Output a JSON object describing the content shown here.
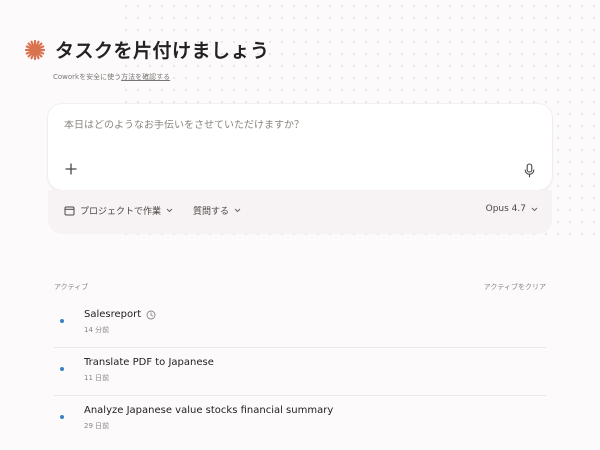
{
  "header": {
    "title": "タスクを片付けましょう",
    "subtitle_prefix": "Coworkを安全に使う",
    "subtitle_link": "方法を確認する"
  },
  "composer": {
    "placeholder": "本日はどのようなお手伝いをさせていただけますか？"
  },
  "toolbar": {
    "project_label": "プロジェクトで作業",
    "ask_label": "質問する",
    "model_label": "Opus 4.7"
  },
  "activity": {
    "heading": "アクティブ",
    "clear_label": "アクティブをクリア",
    "items": [
      {
        "name": "Salesreport",
        "time": "14 分前",
        "icon": "clock-icon"
      },
      {
        "name": "Translate PDF to Japanese",
        "time": "11 日前"
      },
      {
        "name": "Analyze Japanese value stocks financial summary",
        "time": "29 日前"
      }
    ]
  },
  "colors": {
    "accent": "#d9734f",
    "status_dot": "#3b82c4",
    "background": "#fdfafc"
  }
}
